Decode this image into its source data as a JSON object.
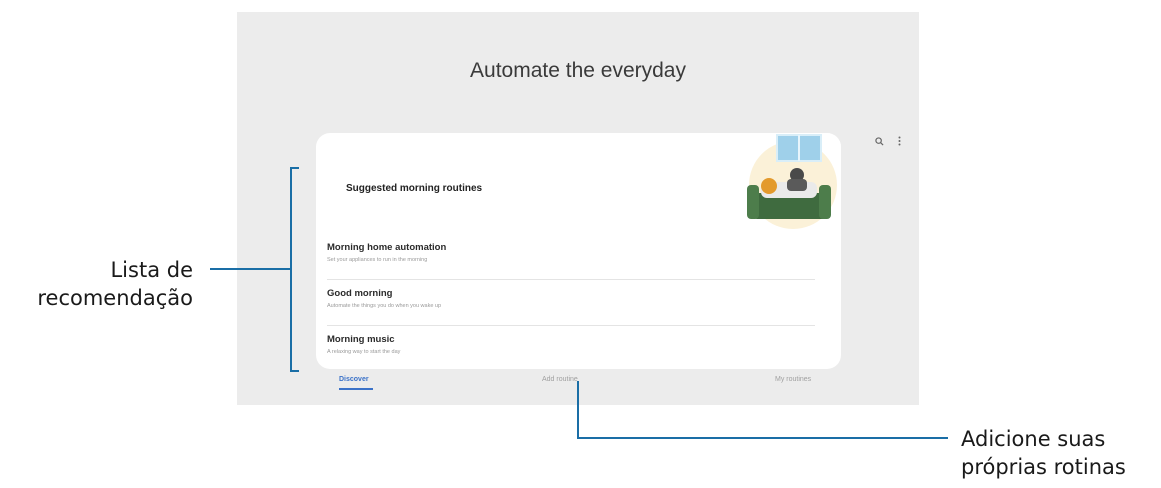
{
  "screen": {
    "title": "Automate the everyday",
    "top_icons": [
      "search-icon",
      "more-options-icon"
    ],
    "card": {
      "heading": "Suggested morning routines",
      "illustration": "person-relaxing-on-couch-illustration",
      "routines": [
        {
          "title": "Morning home automation",
          "description": "Set your appliances to run in the morning"
        },
        {
          "title": "Good morning",
          "description": "Automate the things you do when you wake up"
        },
        {
          "title": "Morning music",
          "description": "A relaxing way to start the day"
        }
      ]
    },
    "bottom_nav": {
      "tabs": [
        "Discover",
        "Add routine",
        "My routines"
      ],
      "active_tab": "Discover",
      "accent_color": "#3b72c8"
    }
  },
  "callouts": {
    "left": {
      "line1": "Lista de",
      "line2": "recomendação"
    },
    "right": {
      "line1": "Adicione suas",
      "line2": "próprias rotinas"
    },
    "line_color": "#1a6ea6"
  }
}
